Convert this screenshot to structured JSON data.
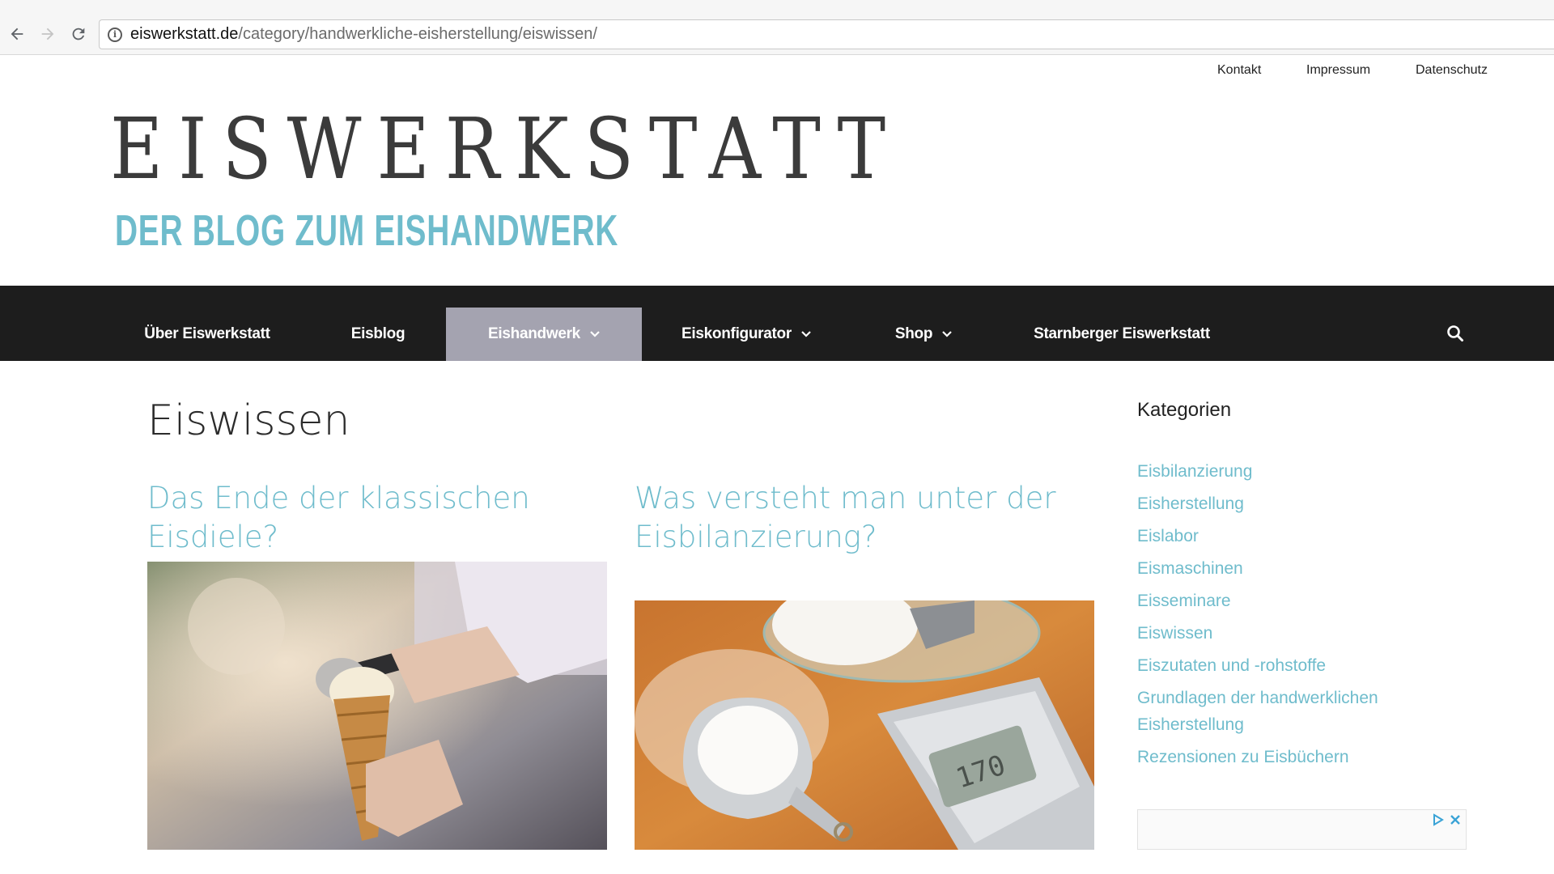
{
  "browser": {
    "url_host": "eiswerkstatt.de",
    "url_path": "/category/handwerkliche-eisherstellung/eiswissen/",
    "icons": [
      "back-arrow-icon",
      "forward-arrow-icon",
      "reload-icon",
      "info-icon"
    ]
  },
  "top_links": [
    "Kontakt",
    "Impressum",
    "Datenschutz"
  ],
  "logo": {
    "title": "EISWERKSTATT",
    "subtitle": "DER BLOG ZUM EISHANDWERK"
  },
  "nav": {
    "items": [
      {
        "label": "Über Eiswerkstatt"
      },
      {
        "label": "Eisblog"
      },
      {
        "label": "Eishandwerk"
      },
      {
        "label": "Eiskonfigurator"
      },
      {
        "label": "Shop"
      },
      {
        "label": "Starnberger Eiswerkstatt"
      }
    ],
    "active": "Eishandwerk",
    "dropdown_items": [
      "Eishandwerk",
      "Eiskonfigurator",
      "Shop"
    ],
    "search_icon": "search-icon"
  },
  "page": {
    "title": "Eiswissen"
  },
  "posts": [
    {
      "title": "Das Ende der klassischen Eisdiele?",
      "image": "ice-cream-scoop-cone-photo"
    },
    {
      "title_line1": "Was versteht man unter der",
      "title_line2": "Eisbilanzierung?",
      "image": "sugar-and-kitchen-scale-photo"
    }
  ],
  "sidebar": {
    "title": "Kategorien",
    "categories": [
      "Eisbilanzierung",
      "Eisherstellung",
      "Eislabor",
      "Eismaschinen",
      "Eisseminare",
      "Eiswissen",
      "Eiszutaten und -rohstoffe",
      "Grundlagen der handwerklichen Eisherstellung",
      "Rezensionen zu Eisbüchern"
    ],
    "ad_icons": [
      "adchoices-icon",
      "close-icon"
    ]
  },
  "colors": {
    "accent": "#6fbccc",
    "nav_bg": "#1d1d1d",
    "nav_active_bg": "#a4a3b0",
    "text": "#2b2b2b"
  }
}
